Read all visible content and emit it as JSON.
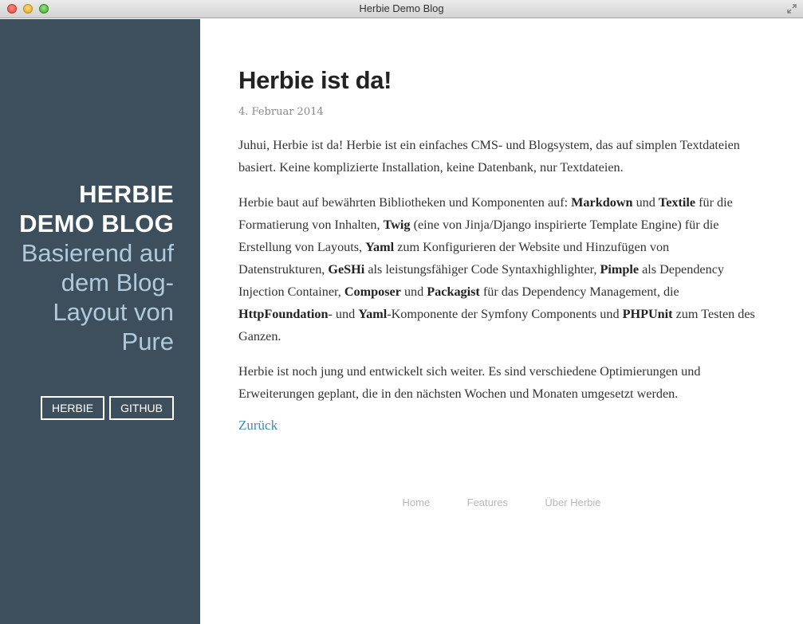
{
  "window": {
    "title": "Herbie Demo Blog"
  },
  "sidebar": {
    "brand_title": "Herbie Demo Blog",
    "brand_tagline": "Basierend auf dem Blog-Layout von Pure",
    "buttons": [
      {
        "label": "Herbie"
      },
      {
        "label": "GitHub"
      }
    ]
  },
  "post": {
    "title": "Herbie ist da!",
    "date": "4. Februar 2014",
    "p1": "Juhui, Herbie ist da! Herbie ist ein einfaches CMS- und Blogsystem, das auf simplen Textdateien basiert. Keine komplizierte Installation, keine Datenbank, nur Textdateien.",
    "p2": {
      "t1": "Herbie baut auf bewährten Bibliotheken und Komponenten auf: ",
      "b1": "Markdown",
      "t2": " und ",
      "b2": "Textile",
      "t3": " für die Formatierung von Inhalten, ",
      "b3": "Twig",
      "t4": " (eine von Jinja/Django inspirierte Template Engine) für die Erstellung von Layouts, ",
      "b4": "Yaml",
      "t5": " zum Konfigurieren der Website und Hinzufügen von Datenstrukturen, ",
      "b5": "GeSHi",
      "t6": " als leistungsfähiger Code Syntaxhighlighter, ",
      "b6": "Pimple",
      "t7": " als Dependency Injection Container, ",
      "b7": "Composer",
      "t8": " und ",
      "b8": "Packagist",
      "t9": " für das Dependency Management, die ",
      "b9": "HttpFoundation",
      "t10": "- und ",
      "b10": "Yaml",
      "t11": "-Komponente der Symfony Components und ",
      "b11": "PHPUnit",
      "t12": " zum Testen des Ganzen."
    },
    "p3": "Herbie ist noch jung und entwickelt sich weiter. Es sind verschiedene Optimierungen und Erweiterungen geplant, die in den nächsten Wochen und Monaten umgesetzt werden.",
    "back_link": "Zurück"
  },
  "footer": {
    "links": [
      {
        "label": "Home"
      },
      {
        "label": "Features"
      },
      {
        "label": "Über Herbie"
      }
    ]
  }
}
